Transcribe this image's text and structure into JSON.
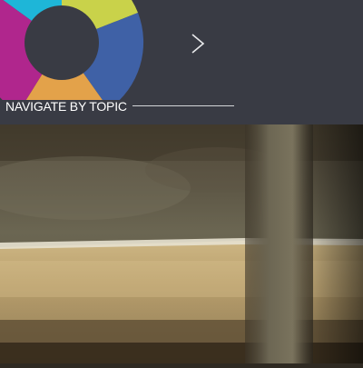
{
  "topic_nav": {
    "label": "NAVIGATE BY TOPIC",
    "wheel_segments": [
      {
        "name": "cyan",
        "color": "#1eb6d8"
      },
      {
        "name": "yellow",
        "color": "#c9d24a"
      },
      {
        "name": "blue",
        "color": "#3f61a6"
      },
      {
        "name": "orange",
        "color": "#e3a24a"
      },
      {
        "name": "magenta",
        "color": "#b0268d"
      }
    ],
    "wheel_center_color": "#393b44",
    "next_icon": "chevron-right-icon"
  },
  "header": {
    "background": "#393b44"
  }
}
